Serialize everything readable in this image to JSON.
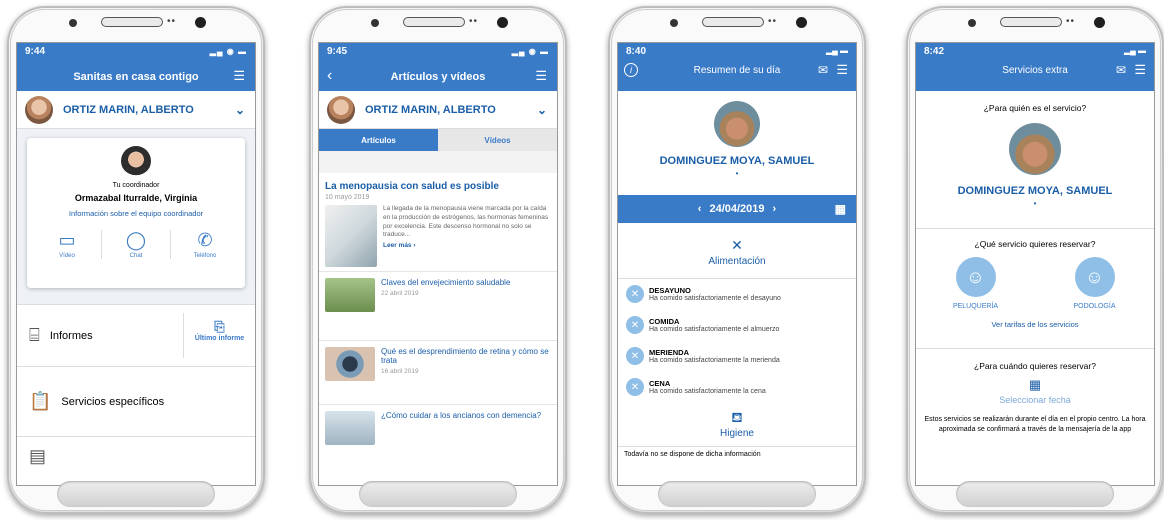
{
  "phone1": {
    "time": "9:44",
    "title": "Sanitas en casa contigo",
    "user": "ORTIZ MARIN, ALBERTO",
    "coordinator_label": "Tu coordinador",
    "coordinator_name": "Ormazabal Iturralde, Virginia",
    "team_link": "Información sobre el equipo coordinador",
    "actions": [
      "Vídeo",
      "Chat",
      "Teléfono"
    ],
    "reports": "Informes",
    "last_report": "Último informe",
    "services": "Servicios específicos"
  },
  "phone2": {
    "time": "9:45",
    "title": "Artículos y vídeos",
    "user": "ORTIZ MARIN, ALBERTO",
    "tab_articles": "Artículos",
    "tab_videos": "Vídeos",
    "featured_title": "La menopausia con salud es posible",
    "featured_date": "10 mayo 2019",
    "featured_text": "La llegada de la menopausia viene marcada por la caída en la producción de estrógenos, las hormonas femeninas por excelencia. Este descenso hormonal no solo se traduce...",
    "read_more": "Leer más",
    "articles": [
      {
        "title": "Claves del envejecimiento saludable",
        "date": "22 abril 2019"
      },
      {
        "title": "Qué es el desprendimiento de retina y cómo se trata",
        "date": "16 abril 2019"
      },
      {
        "title": "¿Cómo cuidar a los ancianos con demencia?",
        "date": ""
      }
    ]
  },
  "phone3": {
    "time": "8:40",
    "title": "Resumen de su día",
    "user": "DOMINGUEZ MOYA, SAMUEL",
    "date": "24/04/2019",
    "food_section": "Alimentación",
    "meals": [
      {
        "name": "DESAYUNO",
        "detail": "Ha comido satisfactoriamente el desayuno"
      },
      {
        "name": "COMIDA",
        "detail": "Ha comido satisfactoriamente el almuerzo"
      },
      {
        "name": "MERIENDA",
        "detail": "Ha comido satisfactoriamente la merienda"
      },
      {
        "name": "CENA",
        "detail": "Ha comido satisfactoriamente la cena"
      }
    ],
    "hygiene_section": "Higiene",
    "hygiene_note": "Todavía no se dispone de dicha información"
  },
  "phone4": {
    "time": "8:42",
    "title": "Servicios extra",
    "who_q": "¿Para quién es el servicio?",
    "user": "DOMINGUEZ MOYA, SAMUEL",
    "what_q": "¿Qué servicio quieres reservar?",
    "svc1": "PELUQUERÍA",
    "svc2": "PODOLOGÍA",
    "rates_link": "Ver tarifas de los servicios",
    "when_q": "¿Para cuándo quieres reservar?",
    "select_date": "Seleccionar fecha",
    "note": "Estos servicios se realizarán durante el día en el propio centro. La hora aproximada se confirmará a través de la mensajería de la app"
  }
}
